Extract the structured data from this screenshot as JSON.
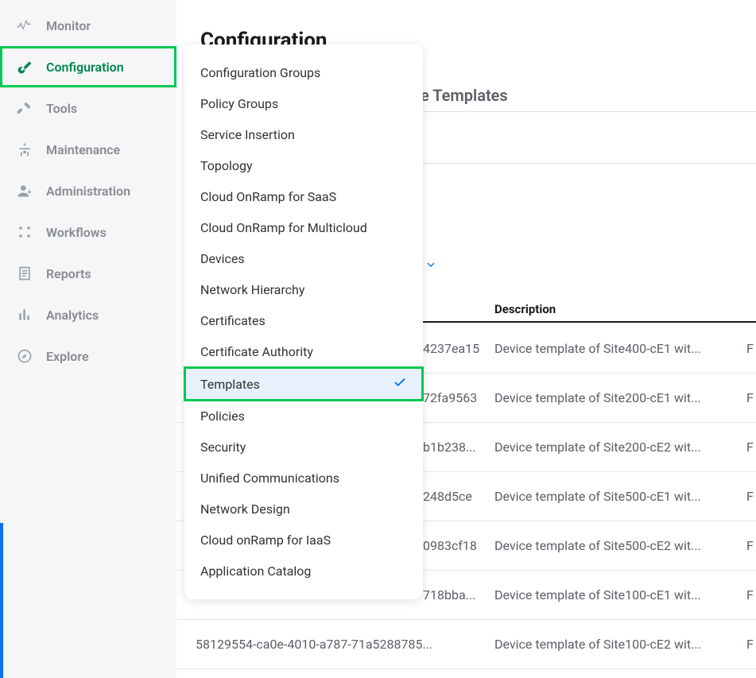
{
  "sidebar": {
    "items": [
      {
        "label": "Monitor",
        "icon": "monitor"
      },
      {
        "label": "Configuration",
        "icon": "configuration",
        "active": true,
        "highlighted": true
      },
      {
        "label": "Tools",
        "icon": "tools"
      },
      {
        "label": "Maintenance",
        "icon": "maintenance"
      },
      {
        "label": "Administration",
        "icon": "administration"
      },
      {
        "label": "Workflows",
        "icon": "workflows"
      },
      {
        "label": "Reports",
        "icon": "reports"
      },
      {
        "label": "Analytics",
        "icon": "analytics"
      },
      {
        "label": "Explore",
        "icon": "explore"
      }
    ]
  },
  "page": {
    "title": "Configuration",
    "subhead_partial": "re Templates"
  },
  "dropdown": {
    "items": [
      {
        "label": "Configuration Groups"
      },
      {
        "label": "Policy Groups"
      },
      {
        "label": "Service Insertion"
      },
      {
        "label": "Topology"
      },
      {
        "label": "Cloud OnRamp for SaaS"
      },
      {
        "label": "Cloud OnRamp for Multicloud"
      },
      {
        "label": "Devices"
      },
      {
        "label": "Network Hierarchy"
      },
      {
        "label": "Certificates"
      },
      {
        "label": "Certificate Authority"
      },
      {
        "label": "Templates",
        "selected": true,
        "highlighted": true
      },
      {
        "label": "Policies"
      },
      {
        "label": "Security"
      },
      {
        "label": "Unified Communications"
      },
      {
        "label": "Network Design"
      },
      {
        "label": "Cloud onRamp for IaaS"
      },
      {
        "label": "Application Catalog"
      }
    ]
  },
  "table": {
    "columns": {
      "description": "Description"
    },
    "rows": [
      {
        "id_tail": "4237ea15",
        "description": "Device template of Site400-cE1 wit...",
        "trail": "F"
      },
      {
        "id_tail": "72fa9563",
        "description": "Device template of Site200-cE1 wit...",
        "trail": "F"
      },
      {
        "id_tail": "b1b238...",
        "description": "Device template of Site200-cE2 wit...",
        "trail": "F"
      },
      {
        "id_tail": "248d5ce",
        "description": "Device template of Site500-cE1 wit...",
        "trail": "F"
      },
      {
        "id_tail": "0983cf18",
        "description": "Device template of Site500-cE2 wit...",
        "trail": "F"
      },
      {
        "id_tail": "718bba...",
        "description": "Device template of Site100-cE1 wit...",
        "trail": "F"
      },
      {
        "id_full": "58129554-ca0e-4010-a787-71a5288785...",
        "description": "Device template of Site100-cE2 wit...",
        "trail": "F"
      }
    ]
  }
}
